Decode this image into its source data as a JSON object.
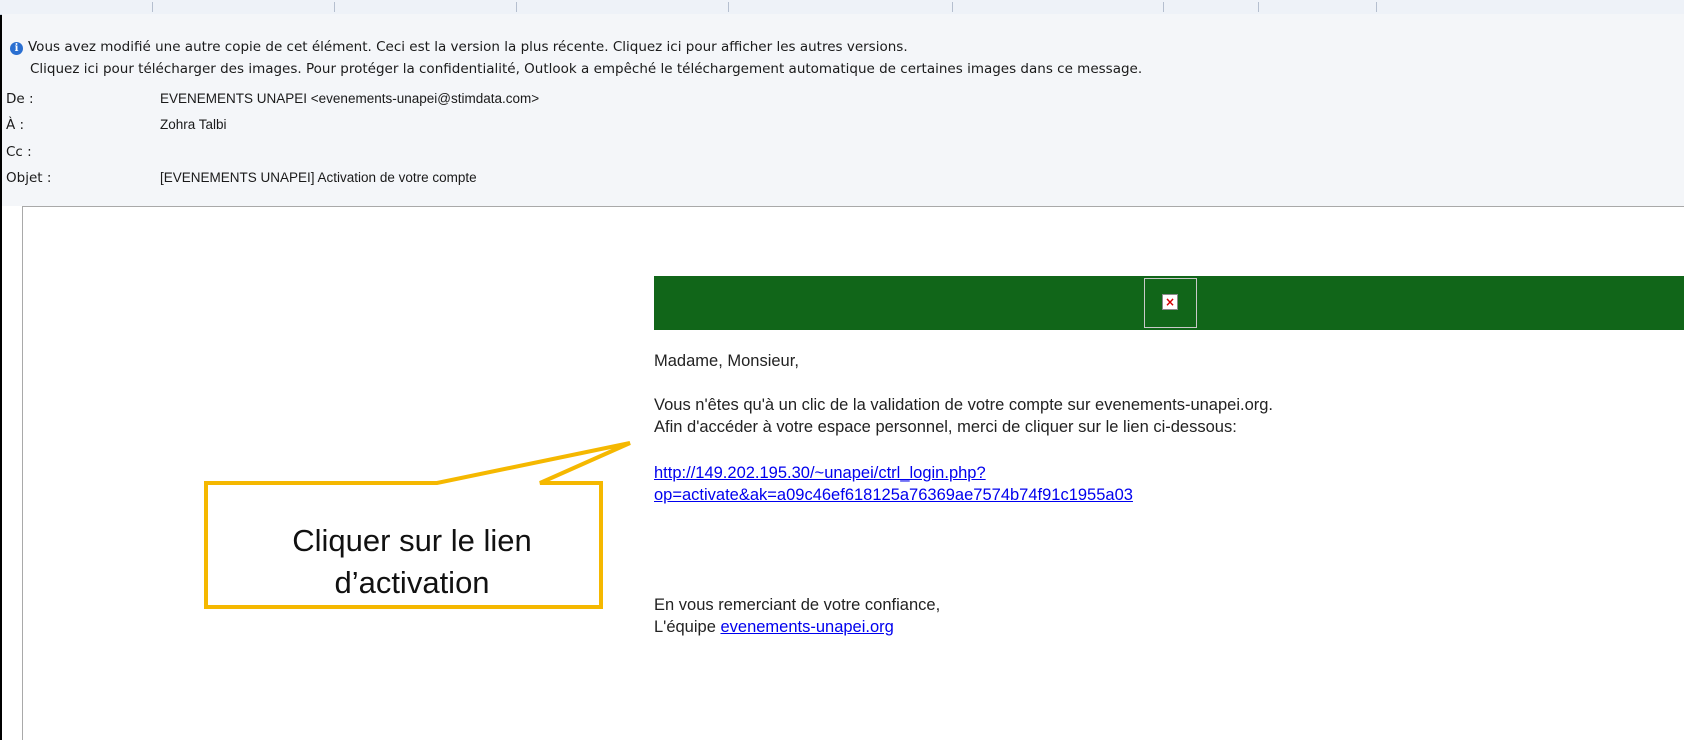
{
  "infobar": {
    "icon": "info-icon",
    "line1": "Vous avez modifié une autre copie de cet élément. Ceci est la version la plus récente. Cliquez ici pour afficher les autres versions.",
    "line2": "Cliquez ici pour télécharger des images. Pour protéger la confidentialité, Outlook a empêché le téléchargement automatique de certaines images dans ce message."
  },
  "headers": {
    "from_label": "De :",
    "from_value": "EVENEMENTS UNAPEI <evenements-unapei@stimdata.com>",
    "to_label": "À :",
    "to_value": "Zohra Talbi",
    "cc_label": "Cc :",
    "cc_value": "",
    "subject_label": "Objet :",
    "subject_value": "[EVENEMENTS UNAPEI] Activation de votre compte"
  },
  "message": {
    "banner_color": "#116619",
    "broken_image_icon": "broken-image-icon",
    "greeting": "Madame, Monsieur,",
    "para1_line1": "Vous n'êtes qu'à un clic de la validation de votre compte sur evenements-unapei.org.",
    "para1_line2": "Afin d'accéder à votre espace personnel, merci de cliquer sur le lien ci-dessous:",
    "link_line1": "http://149.202.195.30/~unapei/ctrl_login.php?",
    "link_line2": "op=activate&ak=a09c46ef618125a76369ae7574b74f91c1955a03",
    "closing_line1": "En vous remerciant de votre confiance,",
    "closing_prefix": "L'équipe ",
    "closing_link": "evenements-unapei.org"
  },
  "callout": {
    "line1": "Cliquer sur le lien",
    "line2": "d’activation",
    "border_color": "#f5b800"
  }
}
